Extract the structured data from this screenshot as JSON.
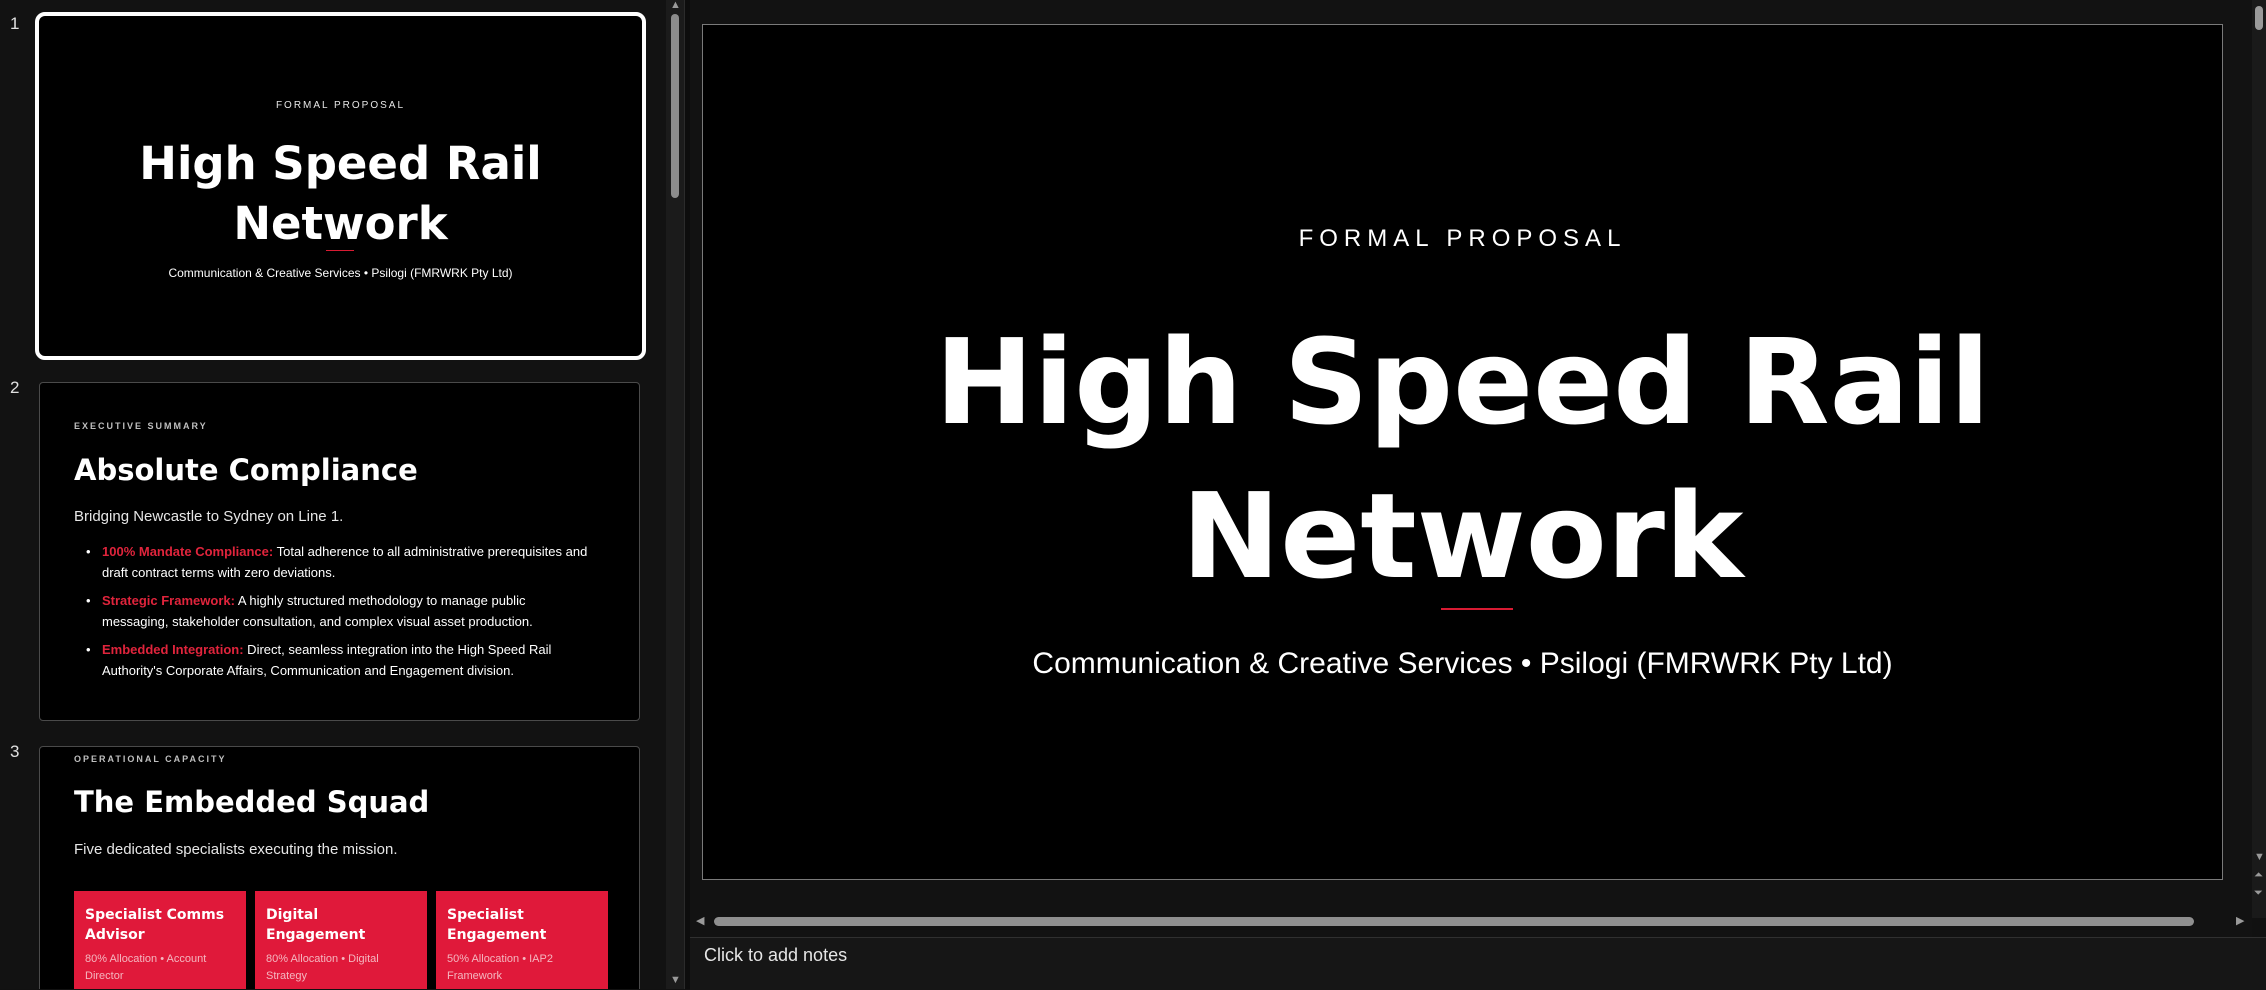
{
  "thumbnails": [
    {
      "number": "1",
      "kicker": "FORMAL PROPOSAL",
      "title_line1": "High Speed Rail",
      "title_line2": "Network",
      "subtitle": "Communication & Creative Services • Psilogi (FMRWRK Pty Ltd)"
    },
    {
      "number": "2",
      "kicker": "EXECUTIVE SUMMARY",
      "title": "Absolute Compliance",
      "subtitle": "Bridging Newcastle to Sydney on Line 1.",
      "bullets": [
        {
          "lead": "100% Mandate Compliance:",
          "text": " Total adherence to all administrative prerequisites and draft contract terms with zero deviations."
        },
        {
          "lead": "Strategic Framework:",
          "text": " A highly structured methodology to manage public messaging, stakeholder consultation, and complex visual asset production."
        },
        {
          "lead": "Embedded Integration:",
          "text": " Direct, seamless integration into the High Speed Rail Authority's Corporate Affairs, Communication and Engagement division."
        }
      ]
    },
    {
      "number": "3",
      "kicker": "OPERATIONAL CAPACITY",
      "title": "The Embedded Squad",
      "subtitle": "Five dedicated specialists executing the mission.",
      "cards": [
        {
          "title": "Specialist Comms Advisor",
          "meta": "80% Allocation • Account Director"
        },
        {
          "title": "Digital Engagement",
          "meta": "80% Allocation • Digital Strategy"
        },
        {
          "title": "Specialist Engagement",
          "meta": "50% Allocation • IAP2 Framework"
        }
      ]
    }
  ],
  "main_slide": {
    "kicker": "FORMAL PROPOSAL",
    "title_line1": "High Speed Rail",
    "title_line2": "Network",
    "subtitle": "Communication & Creative Services • Psilogi (FMRWRK Pty Ltd)"
  },
  "notes": {
    "placeholder": "Click to add notes"
  },
  "icons": {
    "scroll_up": "▲",
    "scroll_down": "▼",
    "scroll_left": "◀",
    "scroll_right": "▶",
    "prev_slide": "⏶",
    "next_slide": "⏷"
  },
  "colors": {
    "accent": "#e0193a",
    "background": "#000000",
    "chrome": "#121212"
  }
}
